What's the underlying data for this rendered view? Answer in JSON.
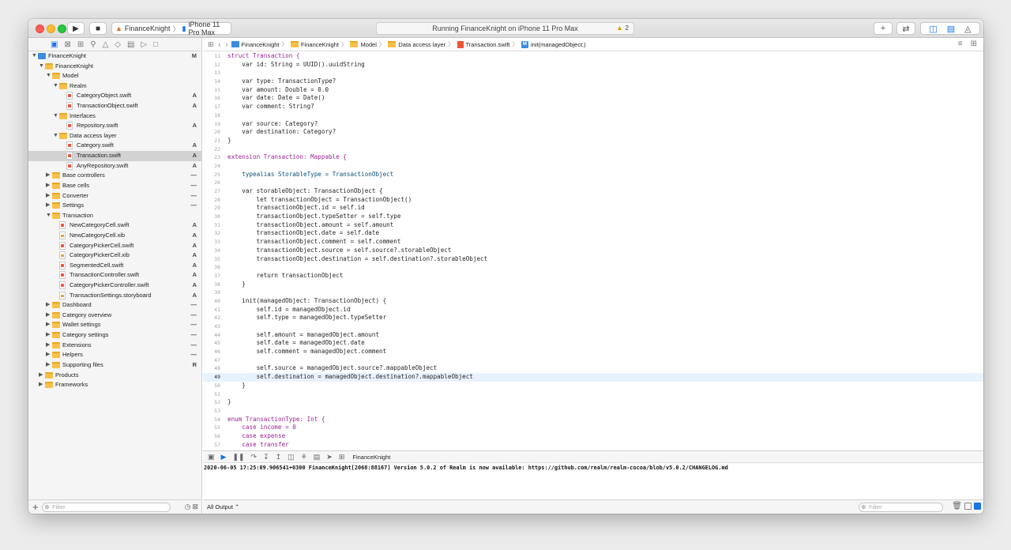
{
  "toolbar": {
    "scheme_name": "FinanceKnight",
    "device_name": "iPhone 11 Pro Max",
    "activity_status": "Running FinanceKnight on iPhone 11 Pro Max",
    "warning_count": "2"
  },
  "navigator": {
    "tree": [
      {
        "label": "FinanceKnight",
        "level": 0,
        "kind": "proj",
        "open": true,
        "status": "M"
      },
      {
        "label": "FinanceKnight",
        "level": 1,
        "kind": "folder",
        "open": true,
        "status": ""
      },
      {
        "label": "Model",
        "level": 2,
        "kind": "folder",
        "open": true,
        "status": ""
      },
      {
        "label": "Realm",
        "level": 3,
        "kind": "folder",
        "open": true,
        "status": ""
      },
      {
        "label": "CategoryObject.swift",
        "level": 4,
        "kind": "swift",
        "status": "A"
      },
      {
        "label": "TransactionObject.swift",
        "level": 4,
        "kind": "swift",
        "status": "A"
      },
      {
        "label": "Interfaces",
        "level": 3,
        "kind": "folder",
        "open": true,
        "status": ""
      },
      {
        "label": "Repository.swift",
        "level": 4,
        "kind": "swift",
        "status": "A"
      },
      {
        "label": "Data access layer",
        "level": 3,
        "kind": "folder",
        "open": true,
        "status": ""
      },
      {
        "label": "Category.swift",
        "level": 4,
        "kind": "swift",
        "status": "A"
      },
      {
        "label": "Transaction.swift",
        "level": 4,
        "kind": "swift",
        "status": "A",
        "selected": true
      },
      {
        "label": "AnyRepository.swift",
        "level": 4,
        "kind": "swift",
        "status": "A"
      },
      {
        "label": "Base controllers",
        "level": 2,
        "kind": "folder",
        "open": false,
        "status": "—"
      },
      {
        "label": "Base cells",
        "level": 2,
        "kind": "folder",
        "open": false,
        "status": "—"
      },
      {
        "label": "Converter",
        "level": 2,
        "kind": "folder",
        "open": false,
        "status": "—"
      },
      {
        "label": "Settings",
        "level": 2,
        "kind": "folder",
        "open": false,
        "status": "—"
      },
      {
        "label": "Transaction",
        "level": 2,
        "kind": "folder",
        "open": true,
        "status": ""
      },
      {
        "label": "NewCategoryCell.swift",
        "level": 3,
        "kind": "swift",
        "status": "A"
      },
      {
        "label": "NewCategoryCell.xib",
        "level": 3,
        "kind": "xib",
        "status": "A"
      },
      {
        "label": "CategoryPickerCell.swift",
        "level": 3,
        "kind": "swift",
        "status": "A"
      },
      {
        "label": "CategoryPickerCell.xib",
        "level": 3,
        "kind": "xib",
        "status": "A"
      },
      {
        "label": "SegmentedCell.swift",
        "level": 3,
        "kind": "swift",
        "status": "A"
      },
      {
        "label": "TransactionController.swift",
        "level": 3,
        "kind": "swift",
        "status": "A"
      },
      {
        "label": "CategoryPickerController.swift",
        "level": 3,
        "kind": "swift",
        "status": "A"
      },
      {
        "label": "TransactionSettings.storyboard",
        "level": 3,
        "kind": "xib",
        "status": "A"
      },
      {
        "label": "Dashboard",
        "level": 2,
        "kind": "folder",
        "open": false,
        "status": "—"
      },
      {
        "label": "Category overview",
        "level": 2,
        "kind": "folder",
        "open": false,
        "status": "—"
      },
      {
        "label": "Wallet settings",
        "level": 2,
        "kind": "folder",
        "open": false,
        "status": "—"
      },
      {
        "label": "Category settings",
        "level": 2,
        "kind": "folder",
        "open": false,
        "status": "—"
      },
      {
        "label": "Extensions",
        "level": 2,
        "kind": "folder",
        "open": false,
        "status": "—"
      },
      {
        "label": "Helpers",
        "level": 2,
        "kind": "folder",
        "open": false,
        "status": "—"
      },
      {
        "label": "Supporting files",
        "level": 2,
        "kind": "folder",
        "open": false,
        "status": "R"
      },
      {
        "label": "Products",
        "level": 1,
        "kind": "folder",
        "open": false,
        "status": ""
      },
      {
        "label": "Frameworks",
        "level": 1,
        "kind": "folder",
        "open": false,
        "status": ""
      }
    ],
    "filter_placeholder": "Filter"
  },
  "jumpbar": {
    "crumbs": [
      {
        "label": "FinanceKnight",
        "kind": "proj"
      },
      {
        "label": "FinanceKnight",
        "kind": "folder"
      },
      {
        "label": "Model",
        "kind": "folder"
      },
      {
        "label": "Data access layer",
        "kind": "folder"
      },
      {
        "label": "Transaction.swift",
        "kind": "swift"
      },
      {
        "label": "init(managedObject:)",
        "kind": "method"
      }
    ]
  },
  "editor": {
    "current_line": 49,
    "lines": [
      {
        "n": 11,
        "text": "struct Transaction {",
        "c": "k"
      },
      {
        "n": 12,
        "text": "    var id: String = UUID().uuidString",
        "c": ""
      },
      {
        "n": 13,
        "text": "",
        "c": ""
      },
      {
        "n": 14,
        "text": "    var type: TransactionType?",
        "c": ""
      },
      {
        "n": 15,
        "text": "    var amount: Double = 0.0",
        "c": ""
      },
      {
        "n": 16,
        "text": "    var date: Date = Date()",
        "c": ""
      },
      {
        "n": 17,
        "text": "    var comment: String?",
        "c": ""
      },
      {
        "n": 18,
        "text": "",
        "c": ""
      },
      {
        "n": 19,
        "text": "    var source: Category?",
        "c": ""
      },
      {
        "n": 20,
        "text": "    var destination: Category?",
        "c": ""
      },
      {
        "n": 21,
        "text": "}",
        "c": ""
      },
      {
        "n": 22,
        "text": "",
        "c": ""
      },
      {
        "n": 23,
        "text": "extension Transaction: Mappable {",
        "c": "k"
      },
      {
        "n": 24,
        "text": "",
        "c": ""
      },
      {
        "n": 25,
        "text": "    typealias StorableType = TransactionObject",
        "c": "t"
      },
      {
        "n": 26,
        "text": "",
        "c": ""
      },
      {
        "n": 27,
        "text": "    var storableObject: TransactionObject {",
        "c": ""
      },
      {
        "n": 28,
        "text": "        let transactionObject = TransactionObject()",
        "c": ""
      },
      {
        "n": 29,
        "text": "        transactionObject.id = self.id",
        "c": ""
      },
      {
        "n": 30,
        "text": "        transactionObject.typeSetter = self.type",
        "c": ""
      },
      {
        "n": 31,
        "text": "        transactionObject.amount = self.amount",
        "c": ""
      },
      {
        "n": 32,
        "text": "        transactionObject.date = self.date",
        "c": ""
      },
      {
        "n": 33,
        "text": "        transactionObject.comment = self.comment",
        "c": ""
      },
      {
        "n": 34,
        "text": "        transactionObject.source = self.source?.storableObject",
        "c": ""
      },
      {
        "n": 35,
        "text": "        transactionObject.destination = self.destination?.storableObject",
        "c": ""
      },
      {
        "n": 36,
        "text": "",
        "c": ""
      },
      {
        "n": 37,
        "text": "        return transactionObject",
        "c": ""
      },
      {
        "n": 38,
        "text": "    }",
        "c": ""
      },
      {
        "n": 39,
        "text": "",
        "c": ""
      },
      {
        "n": 40,
        "text": "    init(managedObject: TransactionObject) {",
        "c": ""
      },
      {
        "n": 41,
        "text": "        self.id = managedObject.id",
        "c": ""
      },
      {
        "n": 42,
        "text": "        self.type = managedObject.typeSetter",
        "c": ""
      },
      {
        "n": 43,
        "text": "",
        "c": ""
      },
      {
        "n": 44,
        "text": "        self.amount = managedObject.amount",
        "c": ""
      },
      {
        "n": 45,
        "text": "        self.date = managedObject.date",
        "c": ""
      },
      {
        "n": 46,
        "text": "        self.comment = managedObject.comment",
        "c": ""
      },
      {
        "n": 47,
        "text": "",
        "c": ""
      },
      {
        "n": 48,
        "text": "        self.source = managedObject.source?.mappableObject",
        "c": ""
      },
      {
        "n": 49,
        "text": "        self.destination = managedObject.destination?.mappableObject",
        "c": ""
      },
      {
        "n": 50,
        "text": "    }",
        "c": ""
      },
      {
        "n": 51,
        "text": "",
        "c": ""
      },
      {
        "n": 52,
        "text": "}",
        "c": ""
      },
      {
        "n": 53,
        "text": "",
        "c": ""
      },
      {
        "n": 54,
        "text": "enum TransactionType: Int {",
        "c": "k"
      },
      {
        "n": 55,
        "text": "    case income = 0",
        "c": "k"
      },
      {
        "n": 56,
        "text": "    case expense",
        "c": "k"
      },
      {
        "n": 57,
        "text": "    case transfer",
        "c": "k"
      }
    ]
  },
  "debug": {
    "target_label": "FinanceKnight",
    "console_output": "2020-06-05 17:25:09.906541+0300 FinanceKnight[2068:88167] Version 5.0.2 of Realm is now available: https://github.com/realm/realm-cocoa/blob/v5.0.2/CHANGELOG.md",
    "scope_label": "All Output ⌃",
    "filter_placeholder": "Filter"
  }
}
